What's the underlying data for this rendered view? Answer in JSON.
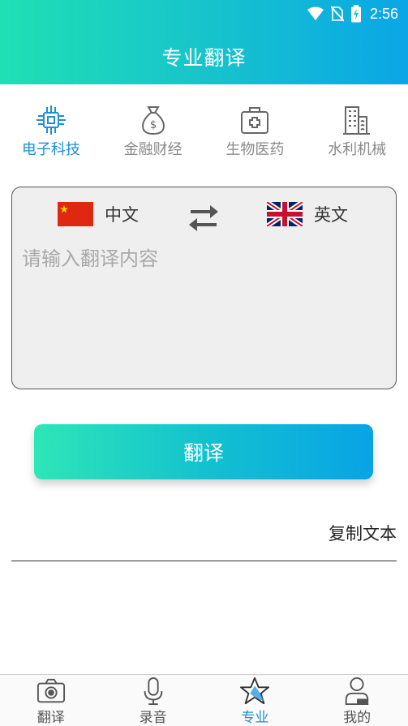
{
  "status_bar": {
    "time": "2:56"
  },
  "header": {
    "title": "专业翻译"
  },
  "categories": [
    {
      "label": "电子科技",
      "icon": "circuit-chip-icon",
      "active": true
    },
    {
      "label": "金融财经",
      "icon": "money-bag-icon",
      "active": false
    },
    {
      "label": "生物医药",
      "icon": "medical-kit-icon",
      "active": false
    },
    {
      "label": "水利机械",
      "icon": "building-icon",
      "active": false
    }
  ],
  "translator": {
    "source_lang": "中文",
    "target_lang": "英文",
    "placeholder": "请输入翻译内容",
    "source_text": ""
  },
  "actions": {
    "translate_label": "翻译",
    "copy_label": "复制文本"
  },
  "tabs": [
    {
      "label": "翻译",
      "icon": "camera-icon",
      "active": false
    },
    {
      "label": "录音",
      "icon": "microphone-icon",
      "active": false
    },
    {
      "label": "专业",
      "icon": "star-icon",
      "active": true
    },
    {
      "label": "我的",
      "icon": "person-icon",
      "active": false
    }
  ],
  "colors": {
    "accent": "#1f8fd6",
    "gradient_start": "#1fe0b4",
    "gradient_end": "#0aa6e6"
  }
}
